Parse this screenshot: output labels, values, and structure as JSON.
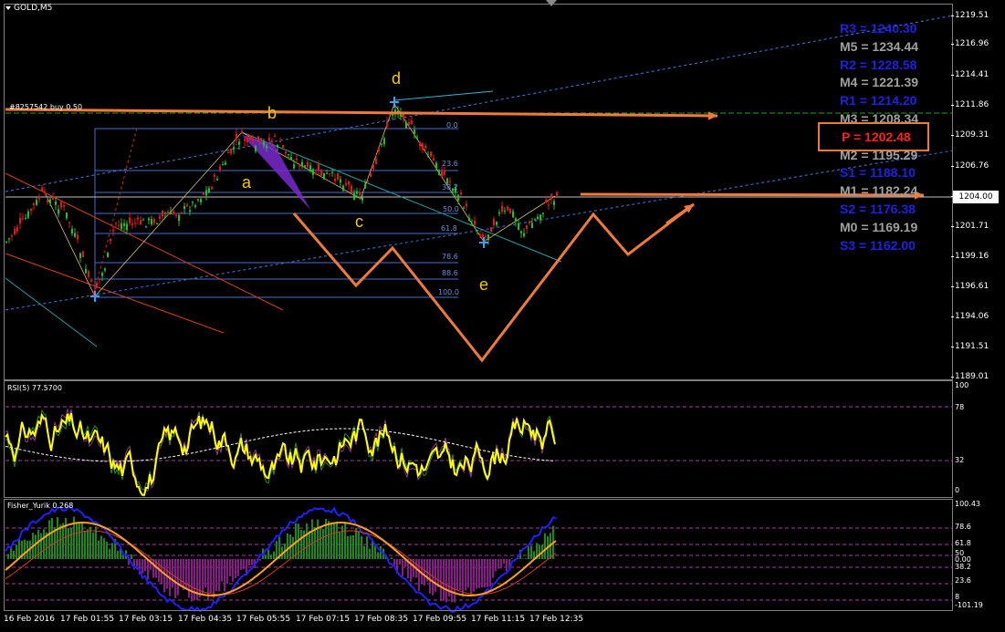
{
  "window": {
    "title": "GOLD,M5",
    "menu_icon": "triangle-down-icon"
  },
  "trade_line": "#8257542 buy 0.50",
  "price_scale": [
    "1219.51",
    "1216.96",
    "1214.41",
    "1211.86",
    "1209.31",
    "1206.76",
    "1204.06",
    "1201.71",
    "1199.16",
    "1196.61",
    "1194.06",
    "1191.51",
    "1189.01"
  ],
  "current_price": "1204.00",
  "pivots": [
    {
      "label": "R3 = 1240.30",
      "color": "#2020e0"
    },
    {
      "label": "M5 = 1234.44",
      "color": "#a0a0a0"
    },
    {
      "label": "R2 = 1228.58",
      "color": "#2020e0"
    },
    {
      "label": "M4 = 1221.39",
      "color": "#a0a0a0"
    },
    {
      "label": "R1 = 1214.20",
      "color": "#2020e0"
    },
    {
      "label": "M3 = 1208.34",
      "color": "#a0a0a0"
    },
    {
      "label": "P  = 1202.48",
      "color": "#ff2020"
    },
    {
      "label": "M2 = 1195.29",
      "color": "#a0a0a0"
    },
    {
      "label": "S1 = 1188.10",
      "color": "#2020e0"
    },
    {
      "label": "M1 = 1182.24",
      "color": "#a0a0a0"
    },
    {
      "label": "S2 = 1176.38",
      "color": "#2020e0"
    },
    {
      "label": "M0 = 1169.19",
      "color": "#a0a0a0"
    },
    {
      "label": "S3 = 1162.00",
      "color": "#2020e0"
    }
  ],
  "fib_levels": [
    "0.0",
    "23.6",
    "38.2",
    "50.0",
    "61.8",
    "78.6",
    "88.6",
    "100.0"
  ],
  "wave_labels": [
    "a",
    "b",
    "c",
    "d",
    "e"
  ],
  "rsi": {
    "title": "RSI(5) 77.5700",
    "ticks": [
      "100",
      "78",
      "32",
      "0"
    ]
  },
  "fisher": {
    "title": "Fisher_Yurik 0.268",
    "ticks": [
      "100.43",
      "78.6",
      "61.8",
      "50",
      "0.00",
      "38.2",
      "23.6",
      "8",
      "-101.19"
    ]
  },
  "time_axis": [
    "16 Feb 2016",
    "17 Feb 01:55",
    "17 Feb 03:15",
    "17 Feb 04:35",
    "17 Feb 05:55",
    "17 Feb 07:15",
    "17 Feb 08:35",
    "17 Feb 09:55",
    "17 Feb 11:15",
    "17 Feb 12:35"
  ],
  "colors": {
    "bull": "#22c022",
    "bear": "#e01818",
    "accent": "#f07a3a",
    "rsi": "#ffff00",
    "fib": "#6b8ed6"
  }
}
